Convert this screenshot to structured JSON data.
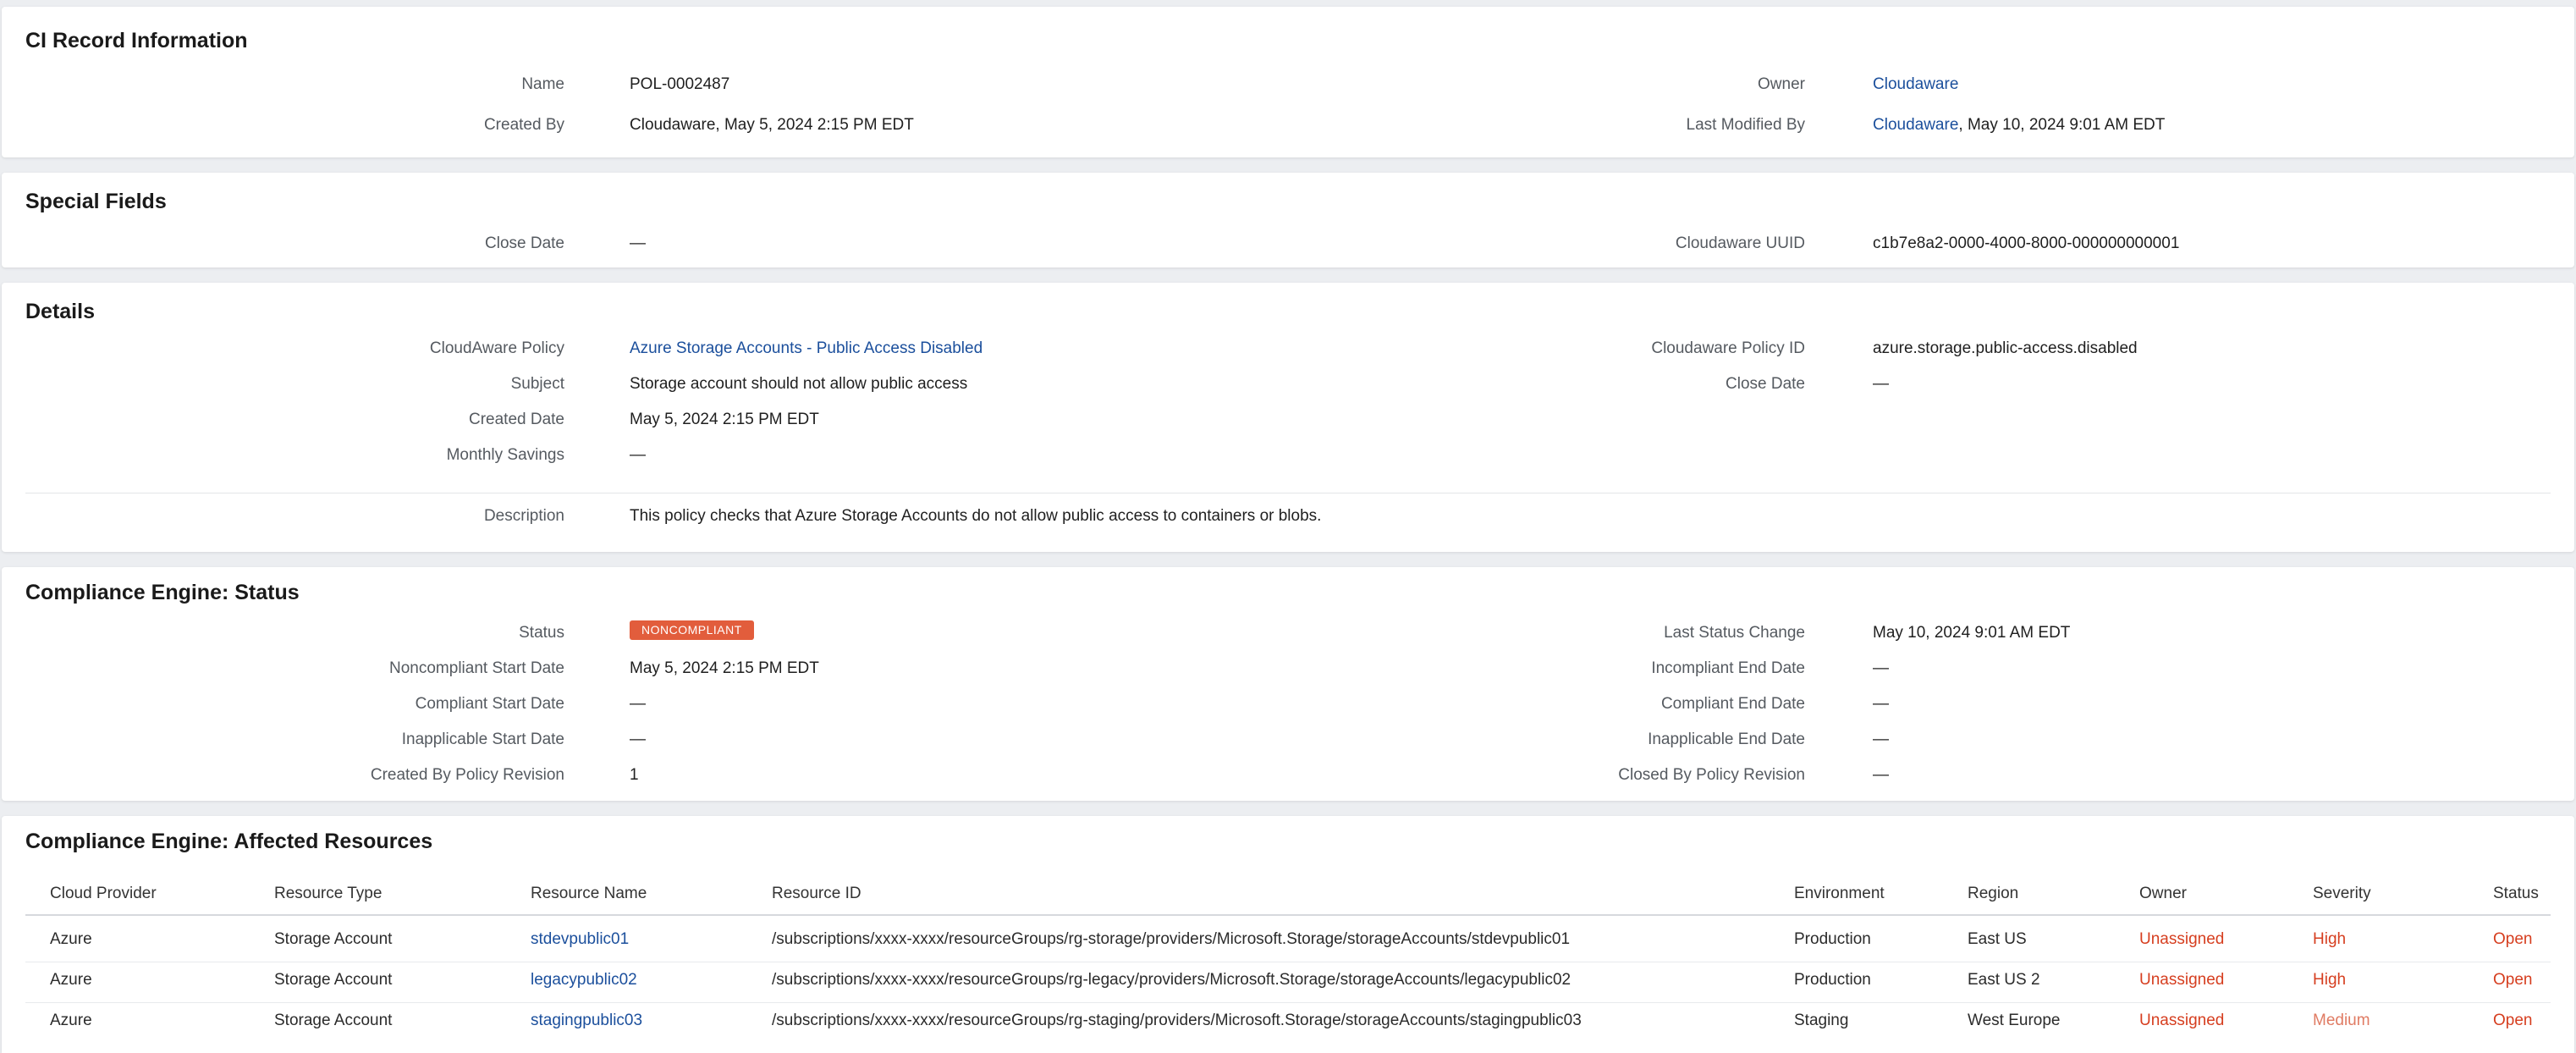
{
  "ci_record": {
    "title": "CI Record Information",
    "name_label": "Name",
    "name_value": "POL-0002487",
    "owner_label": "Owner",
    "owner_value": "Cloudaware",
    "created_by_label": "Created By",
    "created_by_value": "Cloudaware, May 5, 2024 2:15 PM EDT",
    "last_modified_label": "Last Modified By",
    "last_modified_user": "Cloudaware",
    "last_modified_date": ", May 10, 2024 9:01 AM EDT"
  },
  "special_fields": {
    "title": "Special Fields",
    "close_date_label": "Close Date",
    "close_date_value": "—",
    "uuid_label": "Cloudaware UUID",
    "uuid_value": "c1b7e8a2-0000-4000-8000-000000000001"
  },
  "details": {
    "title": "Details",
    "policy_label": "CloudAware Policy",
    "policy_value": "Azure Storage Accounts - Public Access Disabled",
    "policy_id_label": "Cloudaware Policy ID",
    "policy_id_value": "azure.storage.public-access.disabled",
    "subject_label": "Subject",
    "subject_value": "Storage account should not allow public access",
    "close_date_label": "Close Date",
    "close_date_value": "—",
    "created_date_label": "Created Date",
    "created_date_value": "May 5, 2024 2:15 PM EDT",
    "monthly_savings_label": "Monthly Savings",
    "monthly_savings_value": "—",
    "description_label": "Description",
    "description_value": "This policy checks that Azure Storage Accounts do not allow public access to containers or blobs."
  },
  "status": {
    "title": "Compliance Engine: Status",
    "status_label": "Status",
    "status_value": "NONCOMPLIANT",
    "status_color": "#e25d3c",
    "last_change_label": "Last Status Change",
    "last_change_value": "May 10, 2024 9:01 AM EDT",
    "noncompliant_start_label": "Noncompliant Start Date",
    "noncompliant_start_value": "May 5, 2024 2:15 PM EDT",
    "incompliant_end_label": "Incompliant End Date",
    "incompliant_end_value": "—",
    "compliant_start_label": "Compliant Start Date",
    "compliant_start_value": "—",
    "compliant_end_label": "Compliant End Date",
    "compliant_end_value": "—",
    "inapplicable_start_label": "Inapplicable Start Date",
    "inapplicable_start_value": "—",
    "inapplicable_end_label": "Inapplicable End Date",
    "inapplicable_end_value": "—",
    "created_revision_label": "Created By Policy Revision",
    "created_revision_value": "1",
    "closed_revision_label": "Closed By Policy Revision",
    "closed_revision_value": "—"
  },
  "resources": {
    "title": "Compliance Engine: Affected Resources",
    "columns": [
      "Cloud Provider",
      "Resource Type",
      "Resource Name",
      "Resource ID",
      "Environment",
      "Region",
      "Owner",
      "Severity",
      "Status"
    ],
    "rows": [
      {
        "provider": "Azure",
        "type": "Storage Account",
        "name": "stdevpublic01",
        "id": "/subscriptions/xxxx-xxxx/resourceGroups/rg-storage/providers/Microsoft.Storage/storageAccounts/stdevpublic01",
        "environment": "Production",
        "region": "East US",
        "owner": "Unassigned",
        "severity": "High",
        "status": "Open"
      },
      {
        "provider": "Azure",
        "type": "Storage Account",
        "name": "legacypublic02",
        "id": "/subscriptions/xxxx-xxxx/resourceGroups/rg-legacy/providers/Microsoft.Storage/storageAccounts/legacypublic02",
        "environment": "Production",
        "region": "East US 2",
        "owner": "Unassigned",
        "severity": "High",
        "status": "Open"
      },
      {
        "provider": "Azure",
        "type": "Storage Account",
        "name": "stagingpublic03",
        "id": "/subscriptions/xxxx-xxxx/resourceGroups/rg-staging/providers/Microsoft.Storage/storageAccounts/stagingpublic03",
        "environment": "Staging",
        "region": "West Europe",
        "owner": "Unassigned",
        "severity": "Medium",
        "status": "Open"
      }
    ]
  },
  "colors": {
    "link": "#1b4f9c",
    "alert": "#d63e1f",
    "alert_light": "#e07b63",
    "page_bg": "#eceef1"
  }
}
